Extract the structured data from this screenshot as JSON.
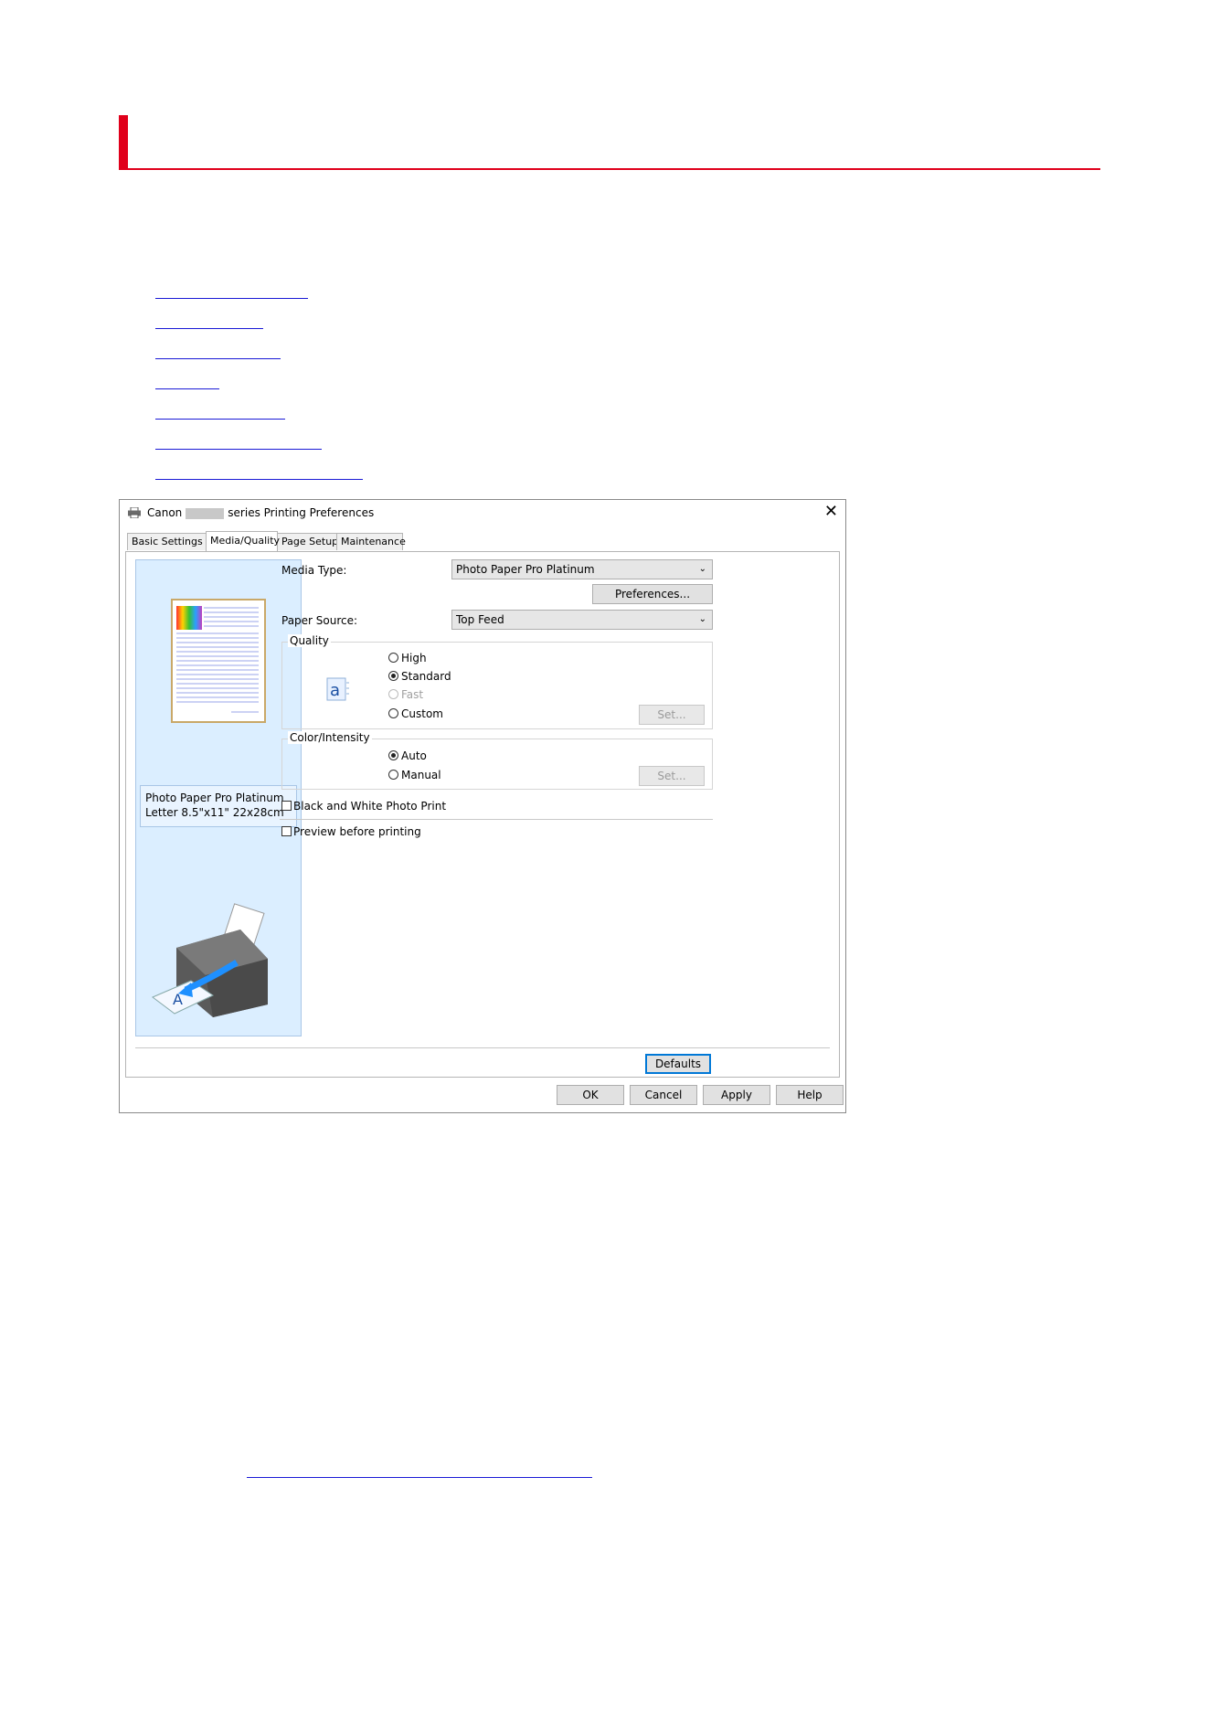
{
  "document": {
    "title": "",
    "links": [
      "",
      "",
      "",
      "",
      "",
      "",
      ""
    ]
  },
  "dialog": {
    "title_prefix": "Canon",
    "title_suffix": "series Printing Preferences",
    "close_label": "✕",
    "tabs": [
      "Basic Settings",
      "Media/Quality",
      "Page Setup",
      "Maintenance"
    ],
    "active_tab": "Media/Quality",
    "media_type_label": "Media Type:",
    "media_type_value": "Photo Paper Pro Platinum",
    "preferences_button": "Preferences...",
    "paper_source_label": "Paper Source:",
    "paper_source_value": "Top Feed",
    "quality": {
      "group_title": "Quality",
      "options": [
        "High",
        "Standard",
        "Fast",
        "Custom"
      ],
      "selected": "Standard",
      "disabled": [
        "Fast"
      ],
      "set_button": "Set..."
    },
    "color_intensity": {
      "group_title": "Color/Intensity",
      "options": [
        "Auto",
        "Manual"
      ],
      "selected": "Auto",
      "set_button": "Set..."
    },
    "bw_photo_print_label": "Black and White Photo Print",
    "preview_before_printing_label": "Preview before printing",
    "preview_paper_line1": "Photo Paper Pro Platinum",
    "preview_paper_line2": "Letter 8.5\"x11\" 22x28cm",
    "defaults_button": "Defaults",
    "footer_buttons": {
      "ok": "OK",
      "cancel": "Cancel",
      "apply": "Apply",
      "help": "Help"
    }
  },
  "colors": {
    "accent_red": "#e0001b",
    "link_blue": "#1a1ad6",
    "preview_pane": "#dbeeff",
    "default_button_border": "#0078d7"
  }
}
